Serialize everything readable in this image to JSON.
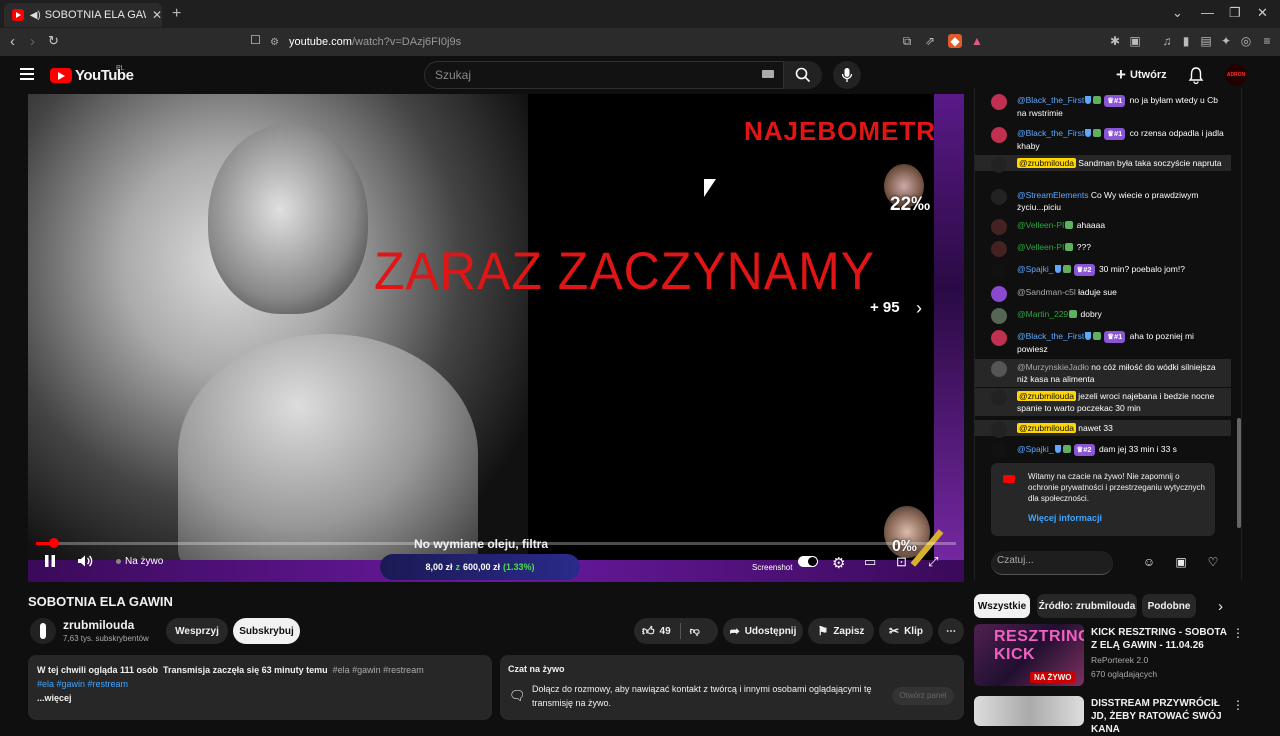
{
  "browser": {
    "tab_title": "SOBOTNIA ELA GAWIN - You",
    "url_domain": "youtube.com",
    "url_path": "/watch?v=DAzj6FI0j9s"
  },
  "header": {
    "logo_text": "YouTube",
    "country": "PL",
    "search_placeholder": "Szukaj",
    "create_label": "Utwórz",
    "avatar_text": "ADRON"
  },
  "player": {
    "headline": "ZARAZ ZACZYNAMY",
    "overlay_text": "NAJEBOMETR",
    "meter_top": "22‰",
    "meter_bottom": "0‰",
    "plus_count": "+ 95",
    "subtitle": "No wymiane oleju, filtra",
    "donation_current": "8,00 zł",
    "donation_sep": "z",
    "donation_goal": "600,00 zł",
    "donation_pct": "(1.33%)",
    "live_label": "Na żywo",
    "screenshot_label": "Screenshot",
    "progress": 0.02
  },
  "video": {
    "title": "SOBOTNIA ELA GAWIN",
    "channel": "zrubmilouda",
    "subscribers": "7,63 tys. subskrybentów",
    "support_label": "Wesprzyj",
    "subscribe_label": "Subskrybuj",
    "likes": "49",
    "share_label": "Udostępnij",
    "save_label": "Zapisz",
    "clip_label": "Klip"
  },
  "description": {
    "watching": "W tej chwili ogląda 111 osób",
    "started": "Transmisja zaczęła się 63 minuty temu",
    "tags_inline": "#ela #gawin #restream",
    "tags": "#ela #gawin #restream",
    "more": "...więcej"
  },
  "chat_info": {
    "title": "Czat na żywo",
    "text": "Dołącz do rozmowy, aby nawiązać kontakt z twórcą i innymi osobami oglądającymi tę transmisję na żywo.",
    "button": "Otwórz panel"
  },
  "chat": {
    "messages": [
      {
        "author": "@Black_the_First",
        "badge": "#1",
        "text": "no ja byłam wtedy u Cb na rwstrimie",
        "style": "blue"
      },
      {
        "author": "@Black_the_First",
        "badge": "#1",
        "text": "co rzensa odpadla i jadla khaby",
        "style": "blue"
      },
      {
        "author": "@zrubmilouda",
        "badge": "",
        "text": "Sandman była taka soczyście napruta",
        "style": "mod"
      },
      {
        "author": "@StreamElements",
        "badge": "",
        "text": "Co Wy wiecie o prawdziwym życiu...piciu",
        "style": "blue"
      },
      {
        "author": "@Velleen-PI",
        "badge": "",
        "text": "ahaaaa",
        "style": "green"
      },
      {
        "author": "@Velleen-PI",
        "badge": "",
        "text": "???",
        "style": "green"
      },
      {
        "author": "@Spajki_",
        "badge": "#2",
        "text": "30 min? poebalo jom!?",
        "style": "blue"
      },
      {
        "author": "@Sandman-c5l",
        "badge": "",
        "text": "ładuje sue",
        "style": "gray"
      },
      {
        "author": "@Martin_229",
        "badge": "",
        "text": "dobry",
        "style": "green"
      },
      {
        "author": "@Black_the_First",
        "badge": "#1",
        "text": "aha to pozniej mi powiesz",
        "style": "blue"
      },
      {
        "author": "@MurzynskieJadło",
        "badge": "",
        "text": "no cóż miłość do wódki silniejsza niż kasa na alimenta",
        "style": "gray"
      },
      {
        "author": "@zrubmilouda",
        "badge": "",
        "text": "jezeli wroci najebana i bedzie nocne spanie to warto poczekac 30 min",
        "style": "mod"
      },
      {
        "author": "@zrubmilouda",
        "badge": "",
        "text": "nawet 33",
        "style": "mod"
      },
      {
        "author": "@Spajki_",
        "badge": "#2",
        "text": "dam jej 33 min i 33 s",
        "style": "blue"
      }
    ],
    "welcome": "Witamy na czacie na żywo! Nie zapomnij o ochronie prywatności i przestrzeganiu wytycznych dla społeczności.",
    "welcome_link": "Więcej informacji",
    "input_placeholder": "Czatuj..."
  },
  "related": {
    "chips": [
      "Wszystkie",
      "Źródło: zrubmilouda",
      "Podobne"
    ],
    "items": [
      {
        "title": "KICK RESZTRING - SOBOTA Z ELĄ GAWIN - 11.04.26",
        "channel": "RePorterek 2.0",
        "meta": "670 oglądających",
        "thumb_text": "RESZTRING KICK",
        "live_badge": "NA ŻYWO"
      },
      {
        "title": "DISSTREAM PRZYWRÓCIŁ JD, ŻEBY RATOWAĆ SWÓJ KANA",
        "channel": "",
        "meta": "",
        "thumb_text": "",
        "live_badge": ""
      }
    ]
  }
}
